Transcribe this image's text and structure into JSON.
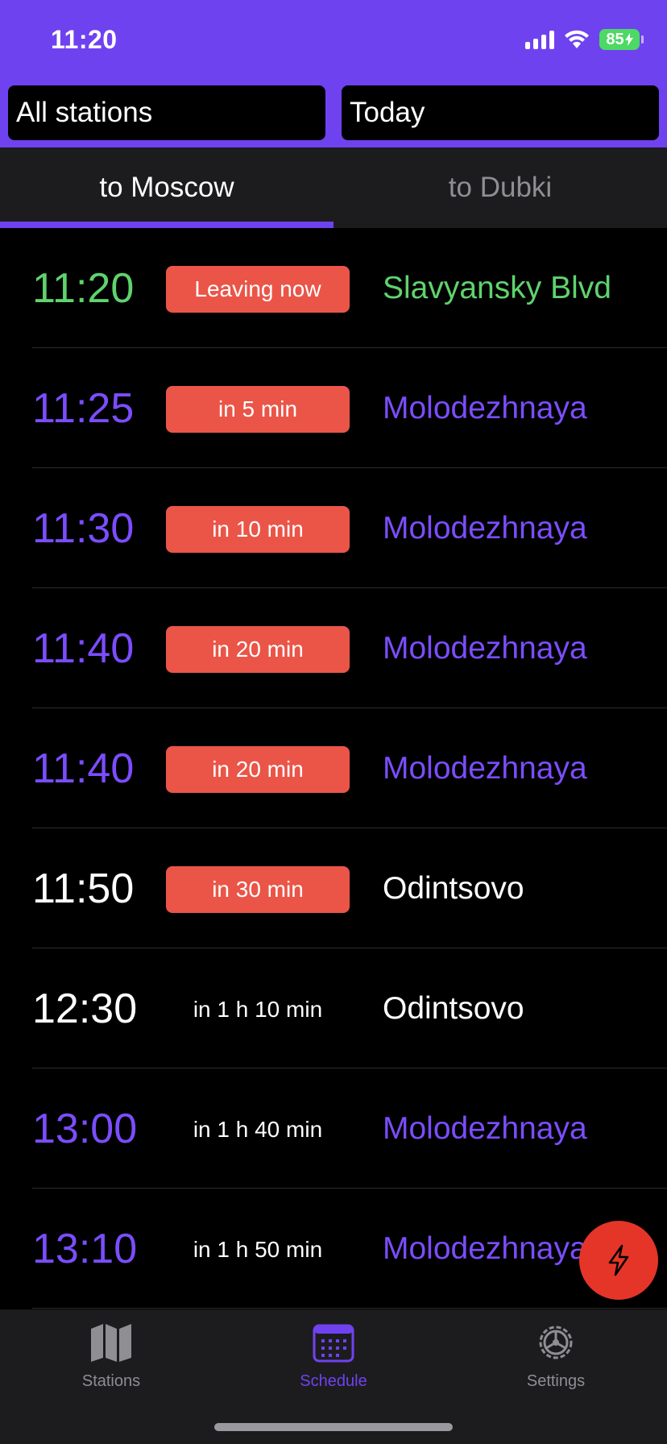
{
  "status_bar": {
    "time": "11:20",
    "battery": "85"
  },
  "header": {
    "station_selector": "All stations",
    "date_selector": "Today"
  },
  "tabs": [
    {
      "label": "to Moscow",
      "active": true
    },
    {
      "label": "to Dubki",
      "active": false
    }
  ],
  "colors": {
    "accent": "#6f42f0",
    "badge": "#ea5548",
    "green": "#5fd36d",
    "purple": "#7b4dff",
    "fab": "#e53528"
  },
  "departures": [
    {
      "time": "11:20",
      "eta": "Leaving now",
      "destination": "Slavyansky Blvd",
      "color": "green",
      "badge": true
    },
    {
      "time": "11:25",
      "eta": "in 5 min",
      "destination": "Molodezhnaya",
      "color": "purple",
      "badge": true
    },
    {
      "time": "11:30",
      "eta": "in 10 min",
      "destination": "Molodezhnaya",
      "color": "purple",
      "badge": true
    },
    {
      "time": "11:40",
      "eta": "in 20 min",
      "destination": "Molodezhnaya",
      "color": "purple",
      "badge": true
    },
    {
      "time": "11:40",
      "eta": "in 20 min",
      "destination": "Molodezhnaya",
      "color": "purple",
      "badge": true
    },
    {
      "time": "11:50",
      "eta": "in 30 min",
      "destination": "Odintsovo",
      "color": "white",
      "badge": true
    },
    {
      "time": "12:30",
      "eta": "in 1 h 10 min",
      "destination": "Odintsovo",
      "color": "white",
      "badge": false
    },
    {
      "time": "13:00",
      "eta": "in 1 h 40 min",
      "destination": "Molodezhnaya",
      "color": "purple",
      "badge": false
    },
    {
      "time": "13:10",
      "eta": "in 1 h 50 min",
      "destination": "Molodezhnaya",
      "color": "purple",
      "badge": false
    }
  ],
  "fab": {
    "icon": "lightning-icon"
  },
  "tabbar": [
    {
      "label": "Stations",
      "icon": "map-icon",
      "active": false
    },
    {
      "label": "Schedule",
      "icon": "calendar-icon",
      "active": true
    },
    {
      "label": "Settings",
      "icon": "gear-icon",
      "active": false
    }
  ]
}
